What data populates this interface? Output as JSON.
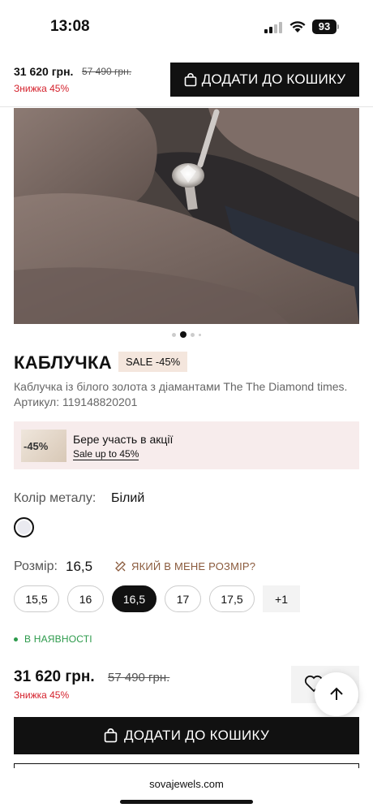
{
  "status_bar": {
    "time": "13:08",
    "battery": "93"
  },
  "sticky_header": {
    "price": "31 620 грн.",
    "old_price": "57 490 грн.",
    "discount": "Знижка 45%",
    "add_to_cart": "ДОДАТИ ДО КОШИКУ"
  },
  "gallery": {
    "total_dots": 4,
    "active_index": 1
  },
  "product": {
    "title": "КАБЛУЧКА",
    "sale_badge": "SALE -45%",
    "description": "Каблучка із білого золота з діамантами The The Diamond times. Артикул: 119148820201"
  },
  "promo": {
    "thumb_label": "-45%",
    "title": "Бере участь в акції",
    "link": "Sale up to 45%"
  },
  "metal": {
    "label": "Колір металу:",
    "value": "Білий",
    "swatch_color": "#eaeaf0"
  },
  "size": {
    "label": "Розмір:",
    "value": "16,5",
    "guide": "ЯКИЙ В МЕНЕ РОЗМІР?",
    "options": [
      "15,5",
      "16",
      "16,5",
      "17",
      "17,5"
    ],
    "selected": "16,5",
    "more": "+1"
  },
  "stock": "В НАЯВНОСТІ",
  "price_block": {
    "price": "31 620 грн.",
    "old_price": "57 490 грн.",
    "discount": "Знижка 45%"
  },
  "add_to_cart": "ДОДАТИ ДО КОШИКУ",
  "browser": {
    "url": "sovajewels.com"
  },
  "colors": {
    "accent_red": "#d4202b",
    "stock_green": "#2c9a4b",
    "badge_bg": "#f4e6dd",
    "promo_bg": "#f7ecec",
    "guide_brown": "#8a5a3c"
  }
}
